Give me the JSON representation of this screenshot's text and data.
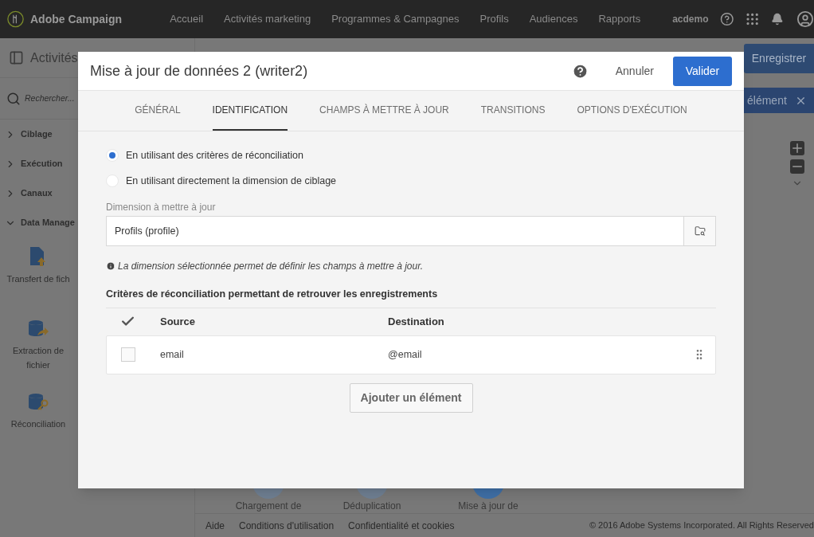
{
  "topbar": {
    "brand": "Adobe Campaign",
    "nav": [
      {
        "label": "Accueil",
        "selected": false
      },
      {
        "label": "Activités marketing",
        "selected": false
      },
      {
        "label": "Programmes & Campagnes",
        "selected": false
      },
      {
        "label": "Profils",
        "selected": false
      },
      {
        "label": "Audiences",
        "selected": false
      },
      {
        "label": "Rapports",
        "selected": false
      }
    ],
    "user": "acdemo"
  },
  "sidebar": {
    "title": "Activités",
    "search_placeholder": "Rechercher...",
    "categories": [
      {
        "label": "Ciblage",
        "expanded": false
      },
      {
        "label": "Exécution",
        "expanded": false
      },
      {
        "label": "Canaux",
        "expanded": false
      },
      {
        "label": "Data Manage",
        "expanded": true
      }
    ],
    "activities": [
      {
        "kind": "transfer",
        "label": "Transfert de fich"
      },
      {
        "kind": "extract",
        "label": "Extraction de fichier"
      },
      {
        "kind": "reconcile",
        "label": "Réconciliation"
      }
    ]
  },
  "workflow": {
    "save_button": "Enregistrer",
    "banner": "élément",
    "nodes": [
      {
        "label": "Chargement de",
        "color": "#6f7f92"
      },
      {
        "label": "Déduplication",
        "color": "#6f7f92"
      },
      {
        "label": "Mise à jour de",
        "color": "#3f6fa6"
      }
    ]
  },
  "footer": {
    "links": [
      "Aide",
      "Conditions d'utilisation",
      "Confidentialité et cookies"
    ],
    "copyright": "© 2016 Adobe Systems Incorporated. All Rights Reserved"
  },
  "dialog": {
    "title": "Mise à jour de données 2 (writer2)",
    "cancel": "Annuler",
    "confirm": "Valider",
    "tabs": [
      {
        "label": "GÉNÉRAL",
        "selected": false
      },
      {
        "label": "IDENTIFICATION",
        "selected": true
      },
      {
        "label": "CHAMPS À METTRE À JOUR",
        "selected": false
      },
      {
        "label": "TRANSITIONS",
        "selected": false
      },
      {
        "label": "OPTIONS D'EXÉCUTION",
        "selected": false
      }
    ],
    "options": [
      {
        "label": "En utilisant des critères de réconciliation",
        "selected": true
      },
      {
        "label": "En utilisant directement la dimension de ciblage",
        "selected": false
      }
    ],
    "dimension": {
      "label": "Dimension à mettre à jour",
      "value": "Profils (profile)"
    },
    "info": "La dimension sélectionnée permet de définir les champs à mettre à jour.",
    "criteria": {
      "title": "Critères de réconciliation permettant de retrouver les enregistrements",
      "columns": [
        "Source",
        "Destination"
      ],
      "rows": [
        {
          "checked": false,
          "source": "email",
          "destination": "@email"
        }
      ]
    },
    "add_button": "Ajouter un élément"
  }
}
